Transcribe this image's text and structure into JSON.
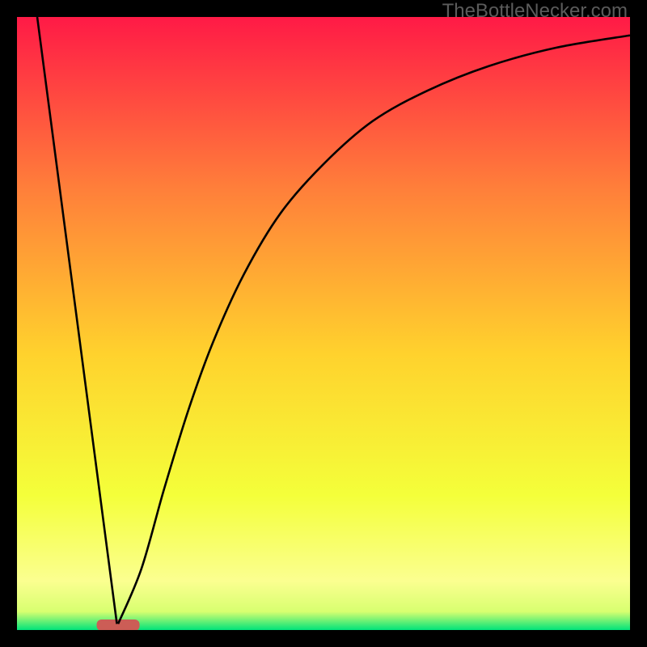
{
  "watermark": "TheBottleNecker.com",
  "chart_data": {
    "type": "line",
    "title": "",
    "xlabel": "",
    "ylabel": "",
    "xlim": [
      0,
      1
    ],
    "ylim": [
      0,
      1
    ],
    "gradient": {
      "top": "#ff1a46",
      "upper_mid": "#ff7f3a",
      "mid": "#ffd22d",
      "lower_mid": "#f4ff3a",
      "band": "#fbff90",
      "bottom": "#00e37a"
    },
    "marker": {
      "x_center_frac": 0.165,
      "half_width_frac": 0.035,
      "color": "#cc5d56"
    },
    "series": [
      {
        "name": "left-slope",
        "type": "line",
        "points": [
          {
            "x": 0.033,
            "y": 1.0
          },
          {
            "x": 0.163,
            "y": 0.01
          }
        ]
      },
      {
        "name": "right-curve",
        "type": "curve",
        "points": [
          {
            "x": 0.165,
            "y": 0.01
          },
          {
            "x": 0.203,
            "y": 0.1
          },
          {
            "x": 0.24,
            "y": 0.23
          },
          {
            "x": 0.28,
            "y": 0.36
          },
          {
            "x": 0.32,
            "y": 0.47
          },
          {
            "x": 0.37,
            "y": 0.58
          },
          {
            "x": 0.43,
            "y": 0.68
          },
          {
            "x": 0.5,
            "y": 0.76
          },
          {
            "x": 0.58,
            "y": 0.83
          },
          {
            "x": 0.67,
            "y": 0.88
          },
          {
            "x": 0.77,
            "y": 0.92
          },
          {
            "x": 0.88,
            "y": 0.95
          },
          {
            "x": 1.0,
            "y": 0.97
          }
        ]
      }
    ]
  }
}
